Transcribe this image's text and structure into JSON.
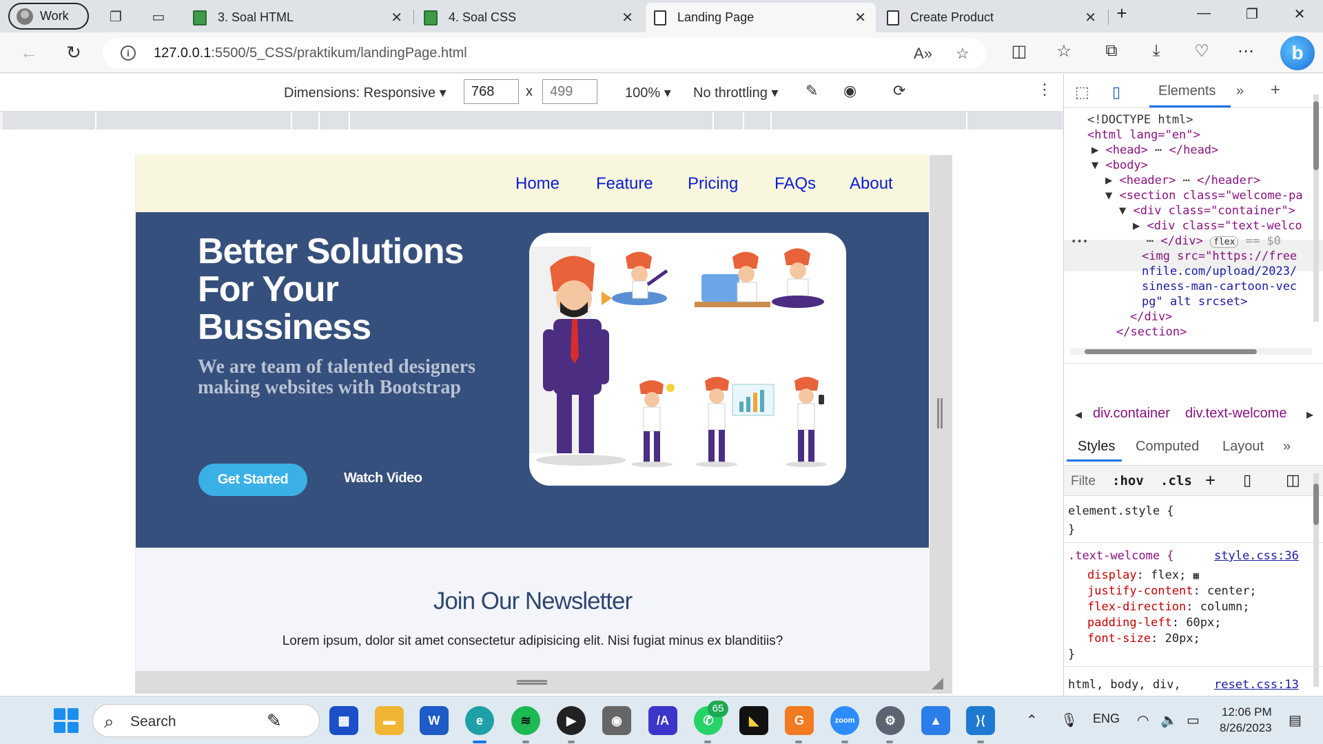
{
  "browser": {
    "profile_label": "Work",
    "tabs": [
      {
        "title": "3. Soal HTML",
        "icon": "book-icon"
      },
      {
        "title": "4. Soal CSS",
        "icon": "book-icon"
      },
      {
        "title": "Landing Page",
        "icon": "page-icon",
        "active": true
      },
      {
        "title": "Create Product",
        "icon": "page-icon"
      }
    ],
    "url_host": "127.0.0.1",
    "url_path": ":5500/5_CSS/praktikum/landingPage.html"
  },
  "device_toolbar": {
    "dimensions_label": "Dimensions: Responsive",
    "width_value": "768",
    "times": "x",
    "height_value": "499",
    "zoom_label": "100%",
    "throttle_label": "No throttling"
  },
  "page": {
    "nav": [
      "Home",
      "Feature",
      "Pricing",
      "FAQs",
      "About"
    ],
    "hero_title_lines": [
      "Better Solutions",
      "For Your",
      "Bussiness"
    ],
    "hero_subtitle": "We are team of talented designers making websites with Bootstrap",
    "btn_start": "Get Started",
    "btn_video": "Watch Video",
    "newsletter_title": "Join Our Newsletter",
    "newsletter_text": "Lorem ipsum, dolor sit amet consectetur adipisicing elit. Nisi fugiat minus ex blanditiis?"
  },
  "devtools": {
    "tab_elements": "Elements",
    "dom_lines": [
      "<!DOCTYPE html>",
      "<html lang=\"en\">",
      "<head>",
      "</head>",
      "<body>",
      "<header>",
      "</header>",
      "<section class=\"welcome-pa",
      "<div class=\"container\">",
      "<div class=\"text-welco",
      "</div>",
      "flex",
      "== $0",
      "<img src=\"https://free",
      "nfile.com/upload/2023/",
      "siness-man-cartoon-vec",
      "pg\" alt srcset>",
      "</div>",
      "</section>"
    ],
    "breadcrumb": [
      "div.container",
      "div.text-welcome"
    ],
    "styles_tabs": [
      "Styles",
      "Computed",
      "Layout"
    ],
    "filter_placeholder": "Filte",
    "filter_hov": ":hov",
    "filter_cls": ".cls",
    "element_style": "element.style {",
    "close_brace": "}",
    "rule_selector": ".text-welcome {",
    "rule_source": "style.css:36",
    "rule_props": [
      {
        "name": "display",
        "value": "flex;"
      },
      {
        "name": "justify-content",
        "value": "center;"
      },
      {
        "name": "flex-direction",
        "value": "column;"
      },
      {
        "name": "padding-left",
        "value": "60px;"
      },
      {
        "name": "font-size",
        "value": "20px;"
      }
    ],
    "reset_selector": "html, body, div,",
    "reset_source": "reset.css:13"
  },
  "taskbar": {
    "search_label": "Search",
    "whatsapp_badge": "65",
    "lang": "ENG",
    "time": "12:06 PM",
    "date": "8/26/2023"
  }
}
